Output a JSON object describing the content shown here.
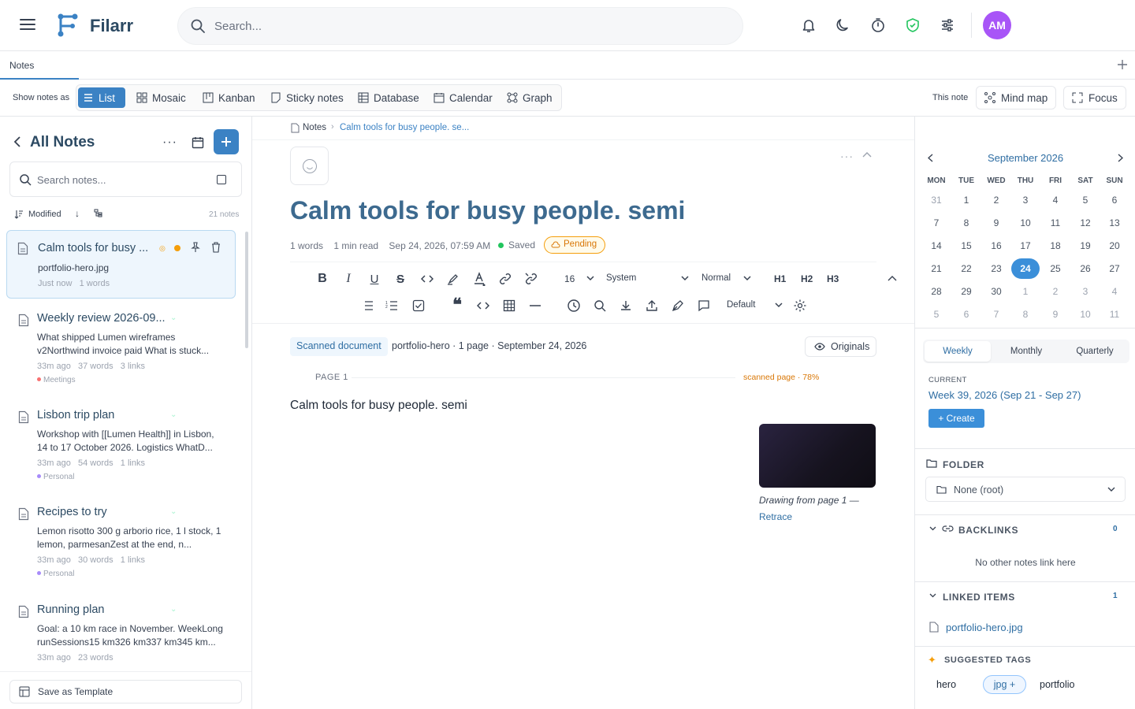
{
  "header": {
    "app_name": "Filarr",
    "search_placeholder": "Search...",
    "avatar_initials": "AM",
    "accent": "#3b82c4",
    "avatar_color": "#a855f7",
    "icons": [
      "menu-icon",
      "logo-icon",
      "search-icon",
      "bell-icon",
      "moon-icon",
      "timer-icon",
      "shield-check-icon",
      "sliders-icon"
    ]
  },
  "tabs": {
    "active": "Notes"
  },
  "views": {
    "label": "Show notes as",
    "items": [
      "List",
      "Mosaic",
      "Kanban",
      "Sticky notes",
      "Database",
      "Calendar",
      "Graph"
    ],
    "active": "List",
    "this_note_label": "This note",
    "mind_map": "Mind map",
    "focus": "Focus"
  },
  "sidebar": {
    "title": "All Notes",
    "search_placeholder": "Search notes...",
    "sort_label": "Modified",
    "count": "21 notes",
    "notes": [
      {
        "title": "Calm tools for busy ...",
        "body": "portfolio-hero.jpg",
        "time": "Just now",
        "words": "1 words",
        "links": "",
        "tag": ""
      },
      {
        "title": "Weekly review 2026-09...",
        "body": "What shipped Lumen wireframes v2Northwind invoice paid What is stuck...",
        "time": "33m ago",
        "words": "37 words",
        "links": "3 links",
        "tag": "Meetings"
      },
      {
        "title": "Lisbon trip plan",
        "body": "Workshop with [[Lumen Health]] in Lisbon, 14 to 17 October 2026. Logistics WhatD...",
        "time": "33m ago",
        "words": "54 words",
        "links": "1 links",
        "tag": "Personal"
      },
      {
        "title": "Recipes to try",
        "body": "Lemon risotto 300 g arborio rice, 1 l stock, 1 lemon, parmesanZest at the end, n...",
        "time": "33m ago",
        "words": "30 words",
        "links": "1 links",
        "tag": "Personal"
      },
      {
        "title": "Running plan",
        "body": "Goal: a 10 km race in November. WeekLong runSessions15 km326 km337 km345 km...",
        "time": "33m ago",
        "words": "23 words",
        "links": "",
        "tag": ""
      }
    ],
    "save_template": "Save as Template"
  },
  "editor": {
    "breadcrumb_root": "Notes",
    "breadcrumb_current": "Calm tools for busy people. se...",
    "title": "Calm tools for busy people. semi",
    "words": "1 words",
    "read_time": "1 min read",
    "date": "Sep 24, 2026, 07:59 AM",
    "saved": "Saved",
    "pending": "Pending",
    "font_size": "16",
    "font_family": "System",
    "block_style": "Normal",
    "headings": [
      "H1",
      "H2",
      "H3"
    ],
    "style_select": "Default",
    "scan_badge": "Scanned document",
    "scan_meta": "portfolio-hero · 1 page · September 24, 2026",
    "originals": "Originals",
    "page_label": "PAGE 1",
    "scan_quality": "scanned page · 78%",
    "body_text": "Calm tools for busy people. semi",
    "drawing_caption": "Drawing from page 1 —",
    "retrace": "Retrace"
  },
  "calendar": {
    "month": "September 2026",
    "days": [
      "MON",
      "TUE",
      "WED",
      "THU",
      "FRI",
      "SAT",
      "SUN"
    ],
    "weeks": [
      [
        "31",
        "1",
        "2",
        "3",
        "4",
        "5",
        "6"
      ],
      [
        "7",
        "8",
        "9",
        "10",
        "11",
        "12",
        "13"
      ],
      [
        "14",
        "15",
        "16",
        "17",
        "18",
        "19",
        "20"
      ],
      [
        "21",
        "22",
        "23",
        "24",
        "25",
        "26",
        "27"
      ],
      [
        "28",
        "29",
        "30",
        "1",
        "2",
        "3",
        "4"
      ],
      [
        "5",
        "6",
        "7",
        "8",
        "9",
        "10",
        "11"
      ]
    ],
    "today": "24"
  },
  "periodic": {
    "tabs": [
      "Weekly",
      "Monthly",
      "Quarterly"
    ],
    "active": "Weekly",
    "current_label": "CURRENT",
    "week": "Week 39, 2026 (Sep 21 - Sep 27)",
    "create": "+ Create"
  },
  "folder": {
    "label": "FOLDER",
    "value": "None (root)"
  },
  "backlinks": {
    "label": "BACKLINKS",
    "count": "0",
    "empty": "No other notes link here"
  },
  "linked": {
    "label": "LINKED ITEMS",
    "count": "1",
    "item": "portfolio-hero.jpg"
  },
  "suggested": {
    "label": "SUGGESTED TAGS",
    "tags": [
      "hero",
      "jpg +",
      "portfolio"
    ]
  }
}
